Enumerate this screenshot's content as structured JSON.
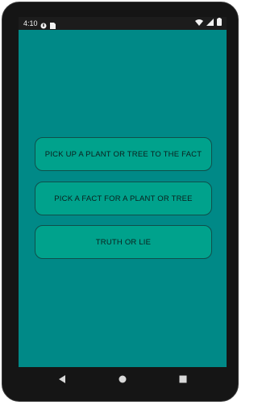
{
  "status_bar": {
    "time": "4:10",
    "icons": [
      "notification-icon",
      "sim-card-icon",
      "wifi-icon",
      "cellular-signal-icon",
      "battery-icon"
    ]
  },
  "main": {
    "buttons": [
      {
        "label": "PICK UP A PLANT OR TREE TO THE FACT"
      },
      {
        "label": "PICK A FACT FOR A PLANT OR TREE"
      },
      {
        "label": "TRUTH OR LIE"
      }
    ]
  },
  "nav_bar": {
    "items": [
      "back-icon",
      "home-icon",
      "recents-icon"
    ]
  },
  "colors": {
    "background": "#008987",
    "button": "#00a28c",
    "button_border": "#0f4f4b",
    "status_bar": "#1c1c1c"
  }
}
